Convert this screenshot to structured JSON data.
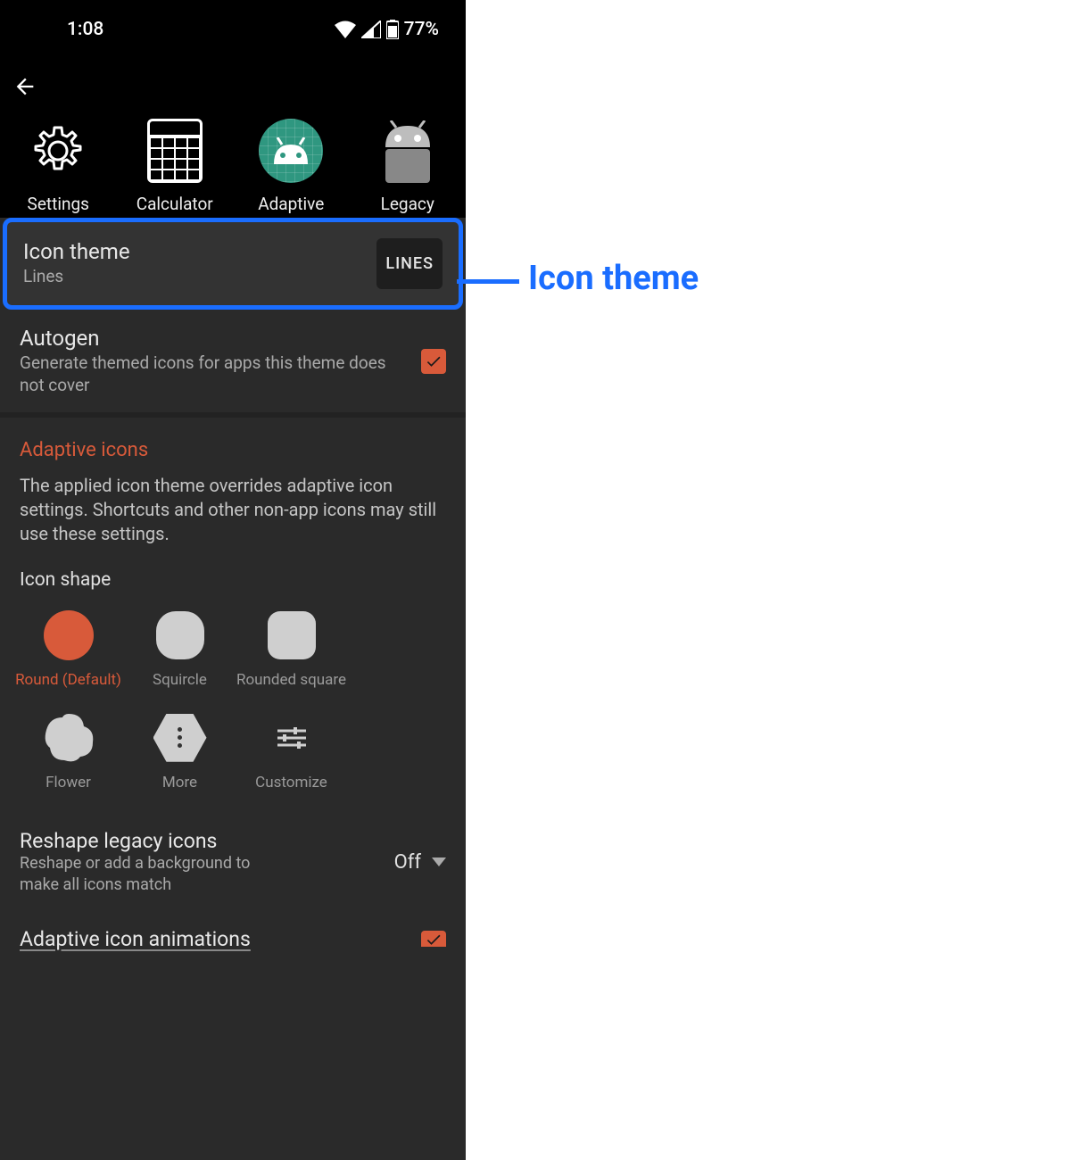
{
  "status": {
    "time": "1:08",
    "battery": "77%"
  },
  "preview": {
    "settings": "Settings",
    "calculator": "Calculator",
    "adaptive": "Adaptive",
    "legacy": "Legacy"
  },
  "iconTheme": {
    "title": "Icon theme",
    "subtitle": "Lines",
    "badge": "LINES"
  },
  "autogen": {
    "title": "Autogen",
    "subtitle": "Generate themed icons for apps this theme does not cover"
  },
  "adaptiveSection": {
    "header": "Adaptive icons",
    "description": "The applied icon theme overrides adaptive icon settings. Shortcuts and other non-app icons may still use these settings.",
    "shapeTitle": "Icon shape"
  },
  "shapes": {
    "round": "Round (Default)",
    "squircle": "Squircle",
    "roundedSquare": "Rounded square",
    "flower": "Flower",
    "more": "More",
    "customize": "Customize"
  },
  "reshape": {
    "title": "Reshape legacy icons",
    "subtitle": "Reshape or add a background to make all icons match",
    "value": "Off"
  },
  "animations": {
    "title": "Adaptive icon animations"
  },
  "callout": "Icon theme"
}
